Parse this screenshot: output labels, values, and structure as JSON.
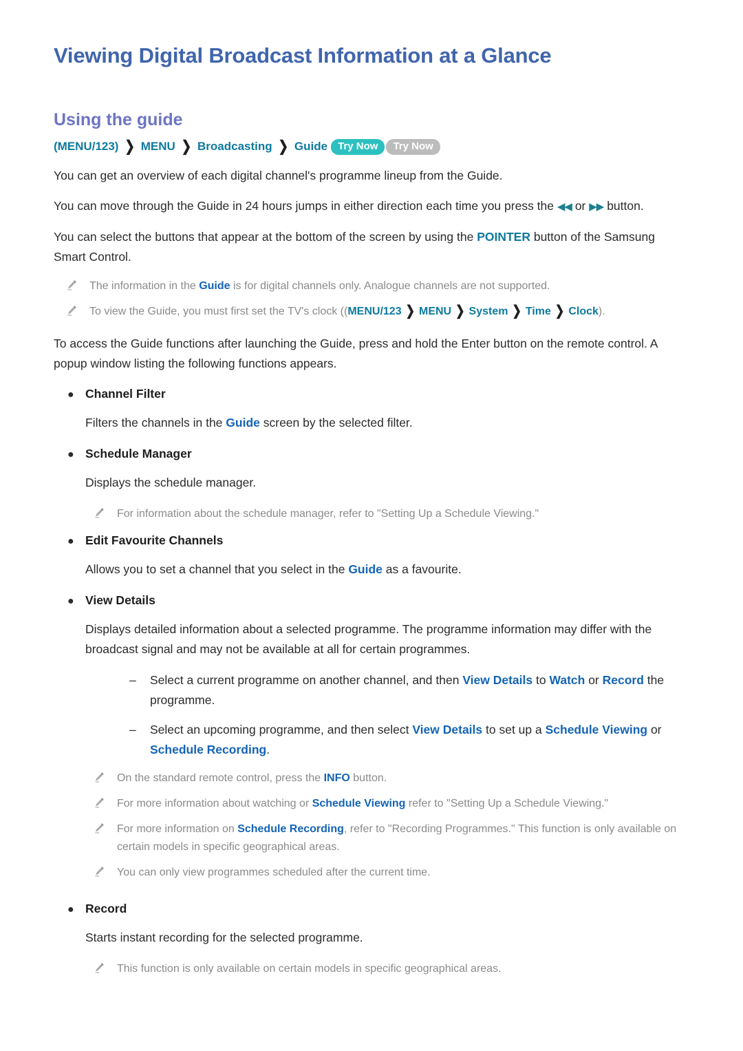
{
  "doc": {
    "title": "Viewing Digital Broadcast Information at a Glance",
    "section_title": "Using the guide"
  },
  "colors": {
    "title": "#4065ac",
    "section_title": "#6d75c2",
    "menu_term": "#0e7a9e",
    "keyword": "#1464b4",
    "badge_active": "#2cc0c0",
    "badge_inactive": "#bcbcbc",
    "note_text": "#8a8a8a",
    "body_text": "#2b2b2b"
  },
  "breadcrumb": {
    "items": [
      "(MENU/123)",
      "MENU",
      "Broadcasting",
      "Guide"
    ],
    "separator": "❯",
    "badges": [
      {
        "label": "Try Now",
        "state": "active"
      },
      {
        "label": "Try Now",
        "state": "inactive"
      }
    ]
  },
  "intro": {
    "p1": "You can get an overview of each digital channel's programme lineup from the Guide.",
    "p2_a": "You can move through the Guide in 24 hours jumps in either direction each time you press the ",
    "p2_rewind": "◀◀",
    "p2_or": " or ",
    "p2_forward": "▶▶",
    "p2_b": " button.",
    "p3_a": "You can select the buttons that appear at the bottom of the screen by using the ",
    "p3_kw": "POINTER",
    "p3_b": " button of the Samsung Smart Control."
  },
  "intro_notes": [
    {
      "before": "The information in the ",
      "kw": "Guide",
      "after": " is for digital channels only. Analogue channels are not supported."
    }
  ],
  "clock_note": {
    "before": "To view the Guide, you must first set the TV's clock ((",
    "path": [
      "MENU/123",
      "MENU",
      "System",
      "Time",
      "Clock"
    ],
    "after": ")."
  },
  "access": {
    "paragraph": "To access the Guide functions after launching the Guide, press and hold the Enter button on the remote control. A popup window listing the following functions appears."
  },
  "functions": [
    {
      "name": "Channel Filter",
      "desc_before": "Filters the channels in the ",
      "desc_kw": "Guide",
      "desc_after": " screen by the selected filter."
    },
    {
      "name": "Schedule Manager",
      "desc_before": "Displays the schedule manager.",
      "desc_kw": "",
      "desc_after": ""
    },
    {
      "name": "Edit Favourite Channels",
      "desc_before": "Allows you to set a channel that you select in the ",
      "desc_kw": "Guide",
      "desc_after": " as a favourite."
    },
    {
      "name": "View Details",
      "desc_before": "Displays detailed information about a selected programme. The programme information may differ with the broadcast signal and may not be available at all for certain programmes.",
      "desc_kw": "",
      "desc_after": ""
    },
    {
      "name": "Record",
      "desc_before": "Starts instant recording for the selected programme.",
      "desc_kw": "",
      "desc_after": ""
    }
  ],
  "schedule_manager_note": {
    "text": "For information about the schedule manager, refer to \"Setting Up a Schedule Viewing.\""
  },
  "view_details_items": [
    {
      "dash": "–",
      "s1": "Select a current programme on another channel, and then ",
      "k1": "View Details",
      "s2": " to ",
      "k2": "Watch",
      "s3": " or ",
      "k3": "Record",
      "s4": " the programme."
    },
    {
      "dash": "–",
      "s1": "Select an upcoming programme, and then select ",
      "k1": "View Details",
      "s2": " to set up a ",
      "k2": "Schedule Viewing",
      "s3": " or ",
      "k3": "Schedule Recording",
      "s4": "."
    }
  ],
  "view_details_notes": [
    {
      "before": "On the standard remote control, press the ",
      "kw": "INFO",
      "after": " button."
    },
    {
      "before": "For more information about watching or ",
      "kw": "Schedule Viewing",
      "after": " refer to \"Setting Up a Schedule Viewing.\""
    },
    {
      "before": "For more information on ",
      "kw": "Schedule Recording",
      "after": ", refer to \"Recording Programmes.\" This function is only available on certain models in specific geographical areas."
    },
    {
      "before": "You can only view programmes scheduled after the current time.",
      "kw": "",
      "after": ""
    }
  ],
  "record_note": {
    "text": "This function is only available on certain models in specific geographical areas."
  }
}
